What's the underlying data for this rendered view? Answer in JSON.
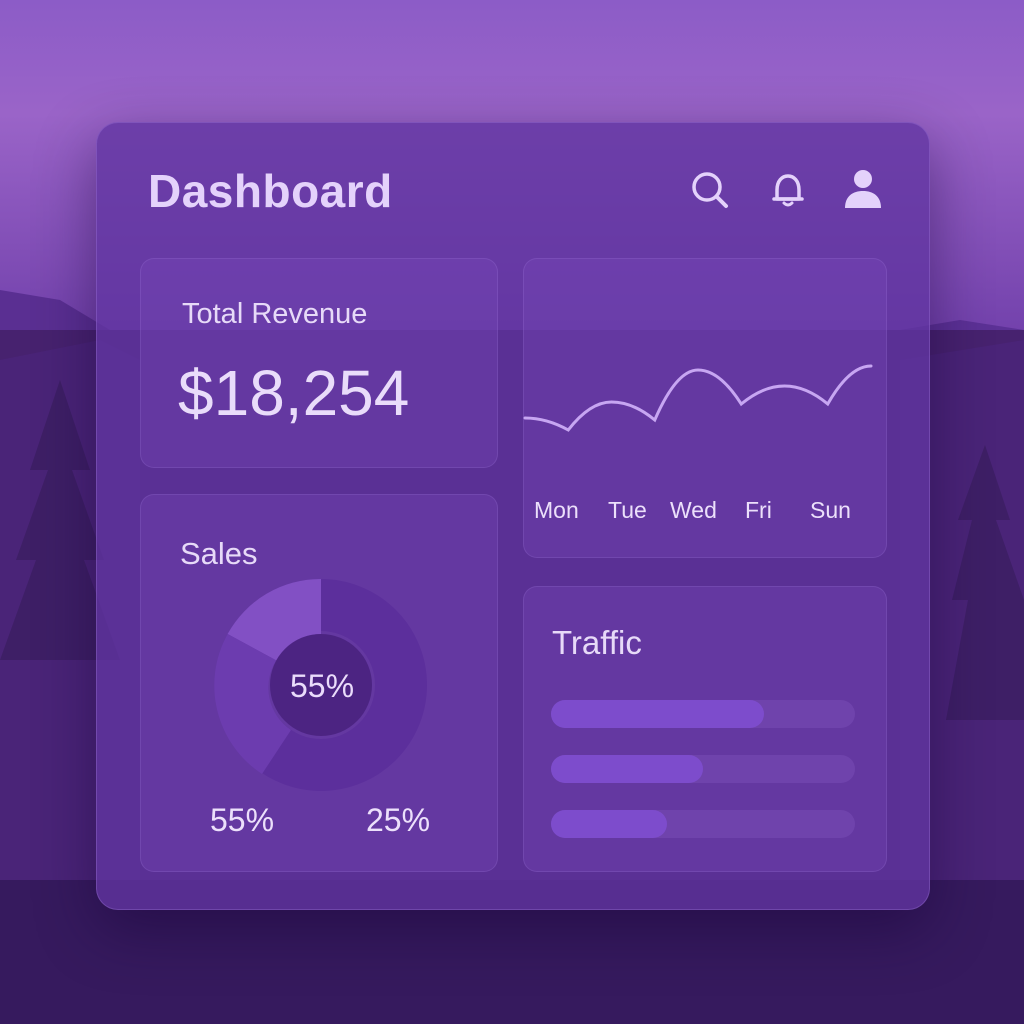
{
  "header": {
    "title": "Dashboard",
    "icons": [
      "search-icon",
      "bell-icon",
      "user-icon"
    ]
  },
  "revenue": {
    "label": "Total Revenue",
    "value": "$18,254"
  },
  "weekly_chart": {
    "days": [
      "Mon",
      "Tue",
      "Wed",
      "Fri",
      "Sun"
    ]
  },
  "sales": {
    "title": "Sales",
    "center_label": "55%",
    "legend": [
      "55%",
      "25%"
    ]
  },
  "traffic": {
    "title": "Traffic",
    "bars": [
      0.7,
      0.5,
      0.38
    ]
  },
  "colors": {
    "accent": "#7d4ccc",
    "text": "#e7daf8",
    "line": "#c7a6f2"
  },
  "chart_data": {
    "type": "line",
    "x": [
      "Mon",
      "Tue",
      "Wed",
      "Fri",
      "Sun"
    ],
    "series": [
      {
        "values": [
          0.15,
          0.35,
          0.75,
          0.55,
          0.8
        ]
      }
    ]
  }
}
